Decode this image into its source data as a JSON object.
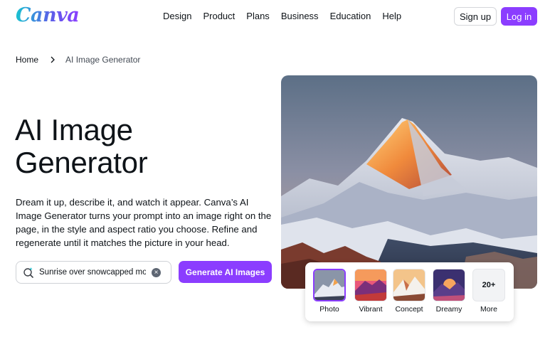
{
  "brand": {
    "logo_text": "Canva",
    "accent": "#8b3dff"
  },
  "nav": {
    "items": [
      "Design",
      "Product",
      "Plans",
      "Business",
      "Education",
      "Help"
    ],
    "signup_label": "Sign up",
    "login_label": "Log in"
  },
  "breadcrumb": {
    "home": "Home",
    "current": "AI Image Generator"
  },
  "hero": {
    "title_line1": "AI Image",
    "title_line2": "Generator",
    "description": "Dream it up, describe it, and watch it appear. Canva’s AI Image Generator turns your prompt into an image right on the page, in the style and aspect ratio you choose. Refine and regenerate until it matches the picture in your head."
  },
  "prompt": {
    "value": "Sunrise over snowcapped mountains",
    "clear_icon": "clear-icon",
    "generate_label": "Generate AI Images"
  },
  "styles": {
    "items": [
      {
        "label": "Photo",
        "selected": true
      },
      {
        "label": "Vibrant",
        "selected": false
      },
      {
        "label": "Concept",
        "selected": false
      },
      {
        "label": "Dreamy",
        "selected": false
      }
    ],
    "more_count": "20+",
    "more_label": "More"
  }
}
